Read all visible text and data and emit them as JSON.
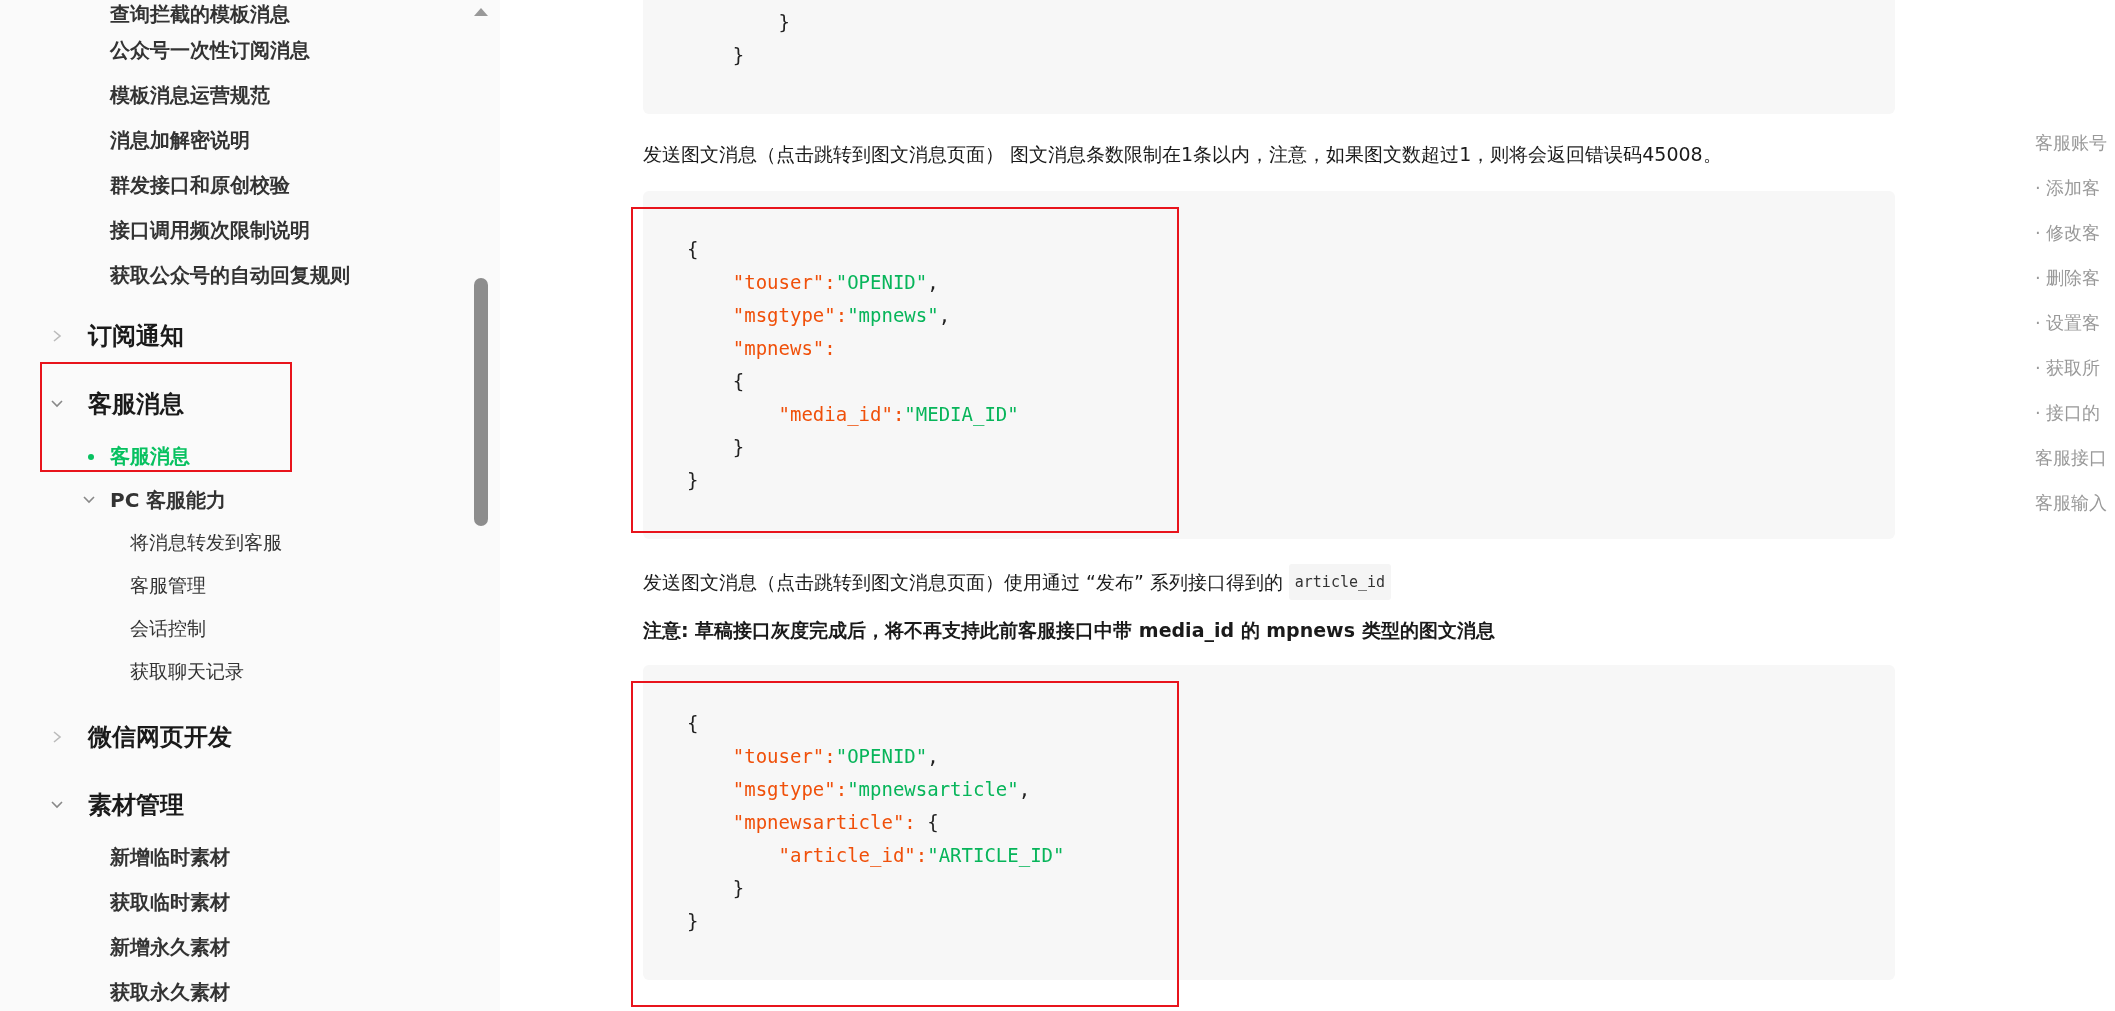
{
  "sidebar": {
    "items": [
      {
        "kind": "page",
        "label": "查询拦截的模板消息",
        "selected": false
      },
      {
        "kind": "page",
        "label": "公众号一次性订阅消息",
        "selected": false
      },
      {
        "kind": "page",
        "label": "模板消息运营规范",
        "selected": false
      },
      {
        "kind": "page",
        "label": "消息加解密说明",
        "selected": false
      },
      {
        "kind": "page",
        "label": "群发接口和原创校验",
        "selected": false
      },
      {
        "kind": "page",
        "label": "接口调用频次限制说明",
        "selected": false
      },
      {
        "kind": "page",
        "label": "获取公众号的自动回复规则",
        "selected": false
      },
      {
        "kind": "section",
        "label": "订阅通知",
        "expanded": false,
        "annotated": false
      },
      {
        "kind": "section",
        "label": "客服消息",
        "expanded": true,
        "annotated": true,
        "children": [
          {
            "kind": "page",
            "label": "客服消息",
            "selected": true
          },
          {
            "kind": "group",
            "label": "PC 客服能力",
            "expanded": true,
            "children": [
              {
                "kind": "subpage",
                "label": "将消息转发到客服",
                "selected": false
              },
              {
                "kind": "subpage",
                "label": "客服管理",
                "selected": false
              },
              {
                "kind": "subpage",
                "label": "会话控制",
                "selected": false
              },
              {
                "kind": "subpage",
                "label": "获取聊天记录",
                "selected": false
              }
            ]
          }
        ]
      },
      {
        "kind": "section",
        "label": "微信网页开发",
        "expanded": false,
        "annotated": false
      },
      {
        "kind": "section",
        "label": "素材管理",
        "expanded": true,
        "annotated": false,
        "children": [
          {
            "kind": "page",
            "label": "新增临时素材",
            "selected": false
          },
          {
            "kind": "page",
            "label": "获取临时素材",
            "selected": false
          },
          {
            "kind": "page",
            "label": "新增永久素材",
            "selected": false
          },
          {
            "kind": "page",
            "label": "获取永久素材",
            "selected": false
          }
        ]
      }
    ]
  },
  "content": [
    {
      "kind": "code",
      "annotated": false,
      "lines": [
        [
          {
            "kind": "punct",
            "text": "        }"
          }
        ],
        [
          {
            "kind": "punct",
            "text": "    }"
          }
        ]
      ]
    },
    {
      "kind": "paragraph",
      "text": "发送图文消息（点击跳转到图文消息页面） 图文消息条数限制在1条以内，注意，如果图文数超过1，则将会返回错误码45008。"
    },
    {
      "kind": "code",
      "annotated": true,
      "lines": [
        [
          {
            "kind": "punct",
            "text": "{"
          }
        ],
        [
          {
            "kind": "key",
            "text": "    \"touser\":"
          },
          {
            "kind": "string",
            "text": "\"OPENID\""
          },
          {
            "kind": "punct",
            "text": ","
          }
        ],
        [
          {
            "kind": "key",
            "text": "    \"msgtype\":"
          },
          {
            "kind": "string",
            "text": "\"mpnews\""
          },
          {
            "kind": "punct",
            "text": ","
          }
        ],
        [
          {
            "kind": "key",
            "text": "    \"mpnews\":"
          }
        ],
        [
          {
            "kind": "punct",
            "text": "    {"
          }
        ],
        [
          {
            "kind": "key",
            "text": "        \"media_id\":"
          },
          {
            "kind": "string",
            "text": "\"MEDIA_ID\""
          }
        ],
        [
          {
            "kind": "punct",
            "text": "    }"
          }
        ],
        [
          {
            "kind": "punct",
            "text": "}"
          }
        ]
      ]
    },
    {
      "kind": "paragraph",
      "text": "发送图文消息（点击跳转到图文消息页面）使用通过 “发布” 系列接口得到的",
      "code": "article_id"
    },
    {
      "kind": "note",
      "text": "注意: 草稿接口灰度完成后，将不再支持此前客服接口中带 media_id 的 mpnews 类型的图文消息"
    },
    {
      "kind": "code",
      "annotated": true,
      "lines": [
        [
          {
            "kind": "punct",
            "text": "{"
          }
        ],
        [
          {
            "kind": "key",
            "text": "    \"touser\":"
          },
          {
            "kind": "string",
            "text": "\"OPENID\""
          },
          {
            "kind": "punct",
            "text": ","
          }
        ],
        [
          {
            "kind": "key",
            "text": "    \"msgtype\":"
          },
          {
            "kind": "string",
            "text": "\"mpnewsarticle\""
          },
          {
            "kind": "punct",
            "text": ","
          }
        ],
        [
          {
            "kind": "key",
            "text": "    \"mpnewsarticle\":"
          },
          {
            "kind": "punct",
            "text": " {"
          }
        ],
        [
          {
            "kind": "key",
            "text": "        \"article_id\":"
          },
          {
            "kind": "string",
            "text": "\"ARTICLE_ID\""
          }
        ],
        [
          {
            "kind": "punct",
            "text": "    }"
          }
        ],
        [
          {
            "kind": "punct",
            "text": "}"
          }
        ]
      ]
    }
  ],
  "toc": {
    "items": [
      "客服账号",
      "· 添加客",
      "· 修改客",
      "· 删除客",
      "· 设置客",
      "· 获取所",
      "· 接口的",
      "客服接口",
      "客服输入"
    ]
  }
}
